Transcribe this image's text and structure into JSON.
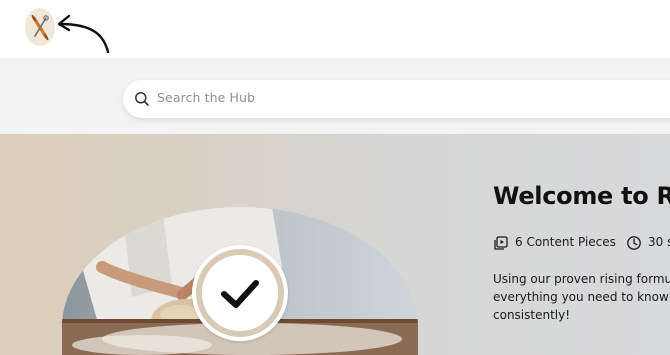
{
  "header": {
    "logo_icon": "rolling-pin-logo-icon",
    "annotation_icon": "curved-arrow-icon"
  },
  "search": {
    "placeholder": "Search the Hub",
    "icon": "search-icon"
  },
  "hero": {
    "title": "Welcome to Ri",
    "image_icon": "dough-kneading-photo",
    "badge_icon": "checkmark-icon",
    "meta": [
      {
        "icon": "video-playlist-icon",
        "label": "6 Content Pieces"
      },
      {
        "icon": "clock-icon",
        "label": "30 s"
      }
    ],
    "description_lines": [
      "Using our proven rising formula,",
      "everything you need to know ab",
      "consistently!"
    ]
  },
  "colors": {
    "badge_ring": "#d9cab5",
    "logo_bg": "#f1e7d8",
    "hero_left": "#dccdb8",
    "hero_right": "#d8d9da"
  }
}
